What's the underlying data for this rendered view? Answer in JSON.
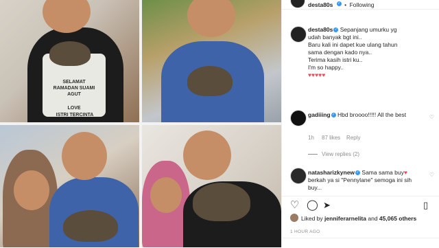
{
  "post": {
    "author": "desta80s",
    "follow_state": "Following",
    "separator": "•"
  },
  "caption": {
    "username": "desta80s",
    "lines": [
      "Sepanjang umurku yg",
      "udah banyak bgt ini..",
      "Baru kali ini dapet kue ulang tahun",
      "sama dengan kado nya..",
      "Terima kasih istri ku..",
      "I'm so happy..",
      "♥♥♥♥♥"
    ]
  },
  "comments": [
    {
      "username": "gadiiing",
      "text": "Hbd broooo!!!!! All the best",
      "age": "1h",
      "likes": "87 likes",
      "reply_label": "Reply",
      "view_replies": "View replies (2)"
    },
    {
      "username": "natasharizkynew",
      "text": "Sama sama buy",
      "text_rest": "berkah ya si \"Pennylane\"",
      "text_cut": "semoga ini sih buy..."
    }
  ],
  "likes": {
    "prefix": "Liked by",
    "user": "jenniferarnelita",
    "conjunction": "and",
    "count": "45,065 others"
  },
  "timestamp": "1 HOUR AGO",
  "photos": {
    "cake_lines": [
      "SELAMAT",
      "RAMADAN SUAMI",
      "AGUT",
      "LOVE",
      "ISTRI TERCINTA"
    ]
  },
  "icons": {
    "like": "heart-outline-icon",
    "comment": "comment-icon",
    "share": "send-icon",
    "save": "bookmark-icon"
  },
  "colors": {
    "link_blue": "#3897f0",
    "heart_red": "#ed4956",
    "meta_gray": "#8e8e8e"
  }
}
